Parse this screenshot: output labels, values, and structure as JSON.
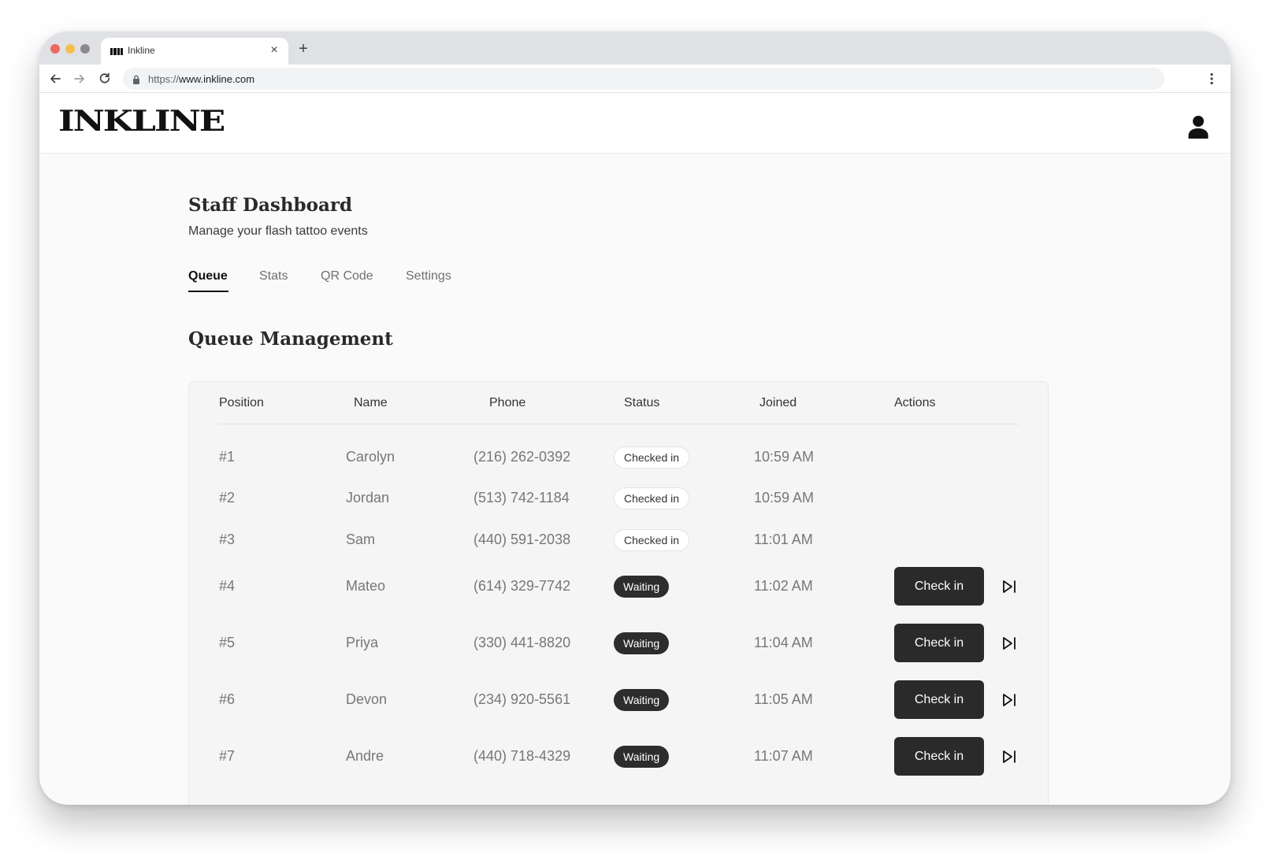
{
  "browser": {
    "tab_title": "Inkline",
    "url_scheme": "https://",
    "url_host": "www.inkline.com",
    "new_tab_label": "+",
    "close_tab_label": "×"
  },
  "site": {
    "logo_text": "INKLINE",
    "account_icon": "user-icon"
  },
  "page": {
    "title": "Staff Dashboard",
    "subtitle": "Manage your flash tattoo events",
    "tabs": [
      {
        "label": "Queue",
        "active": true
      },
      {
        "label": "Stats",
        "active": false
      },
      {
        "label": "QR Code",
        "active": false
      },
      {
        "label": "Settings",
        "active": false
      }
    ],
    "section_title": "Queue Management"
  },
  "table": {
    "headers": {
      "position": "Position",
      "name": "Name",
      "phone": "Phone",
      "status": "Status",
      "joined": "Joined",
      "actions": "Actions"
    },
    "rows": [
      {
        "position": "#1",
        "name": "Carolyn",
        "phone": "(216) 262-0392",
        "status": "Checked in",
        "joined": "10:59 AM",
        "action": ""
      },
      {
        "position": "#2",
        "name": "Jordan",
        "phone": "(513) 742-1184",
        "status": "Checked in",
        "joined": "10:59 AM",
        "action": ""
      },
      {
        "position": "#3",
        "name": "Sam",
        "phone": "(440) 591-2038",
        "status": "Checked in",
        "joined": "11:01 AM",
        "action": ""
      },
      {
        "position": "#4",
        "name": "Mateo",
        "phone": "(614) 329-7742",
        "status": "Waiting",
        "joined": "11:02 AM",
        "action": "Check in"
      },
      {
        "position": "#5",
        "name": "Priya",
        "phone": "(330) 441-8820",
        "status": "Waiting",
        "joined": "11:04 AM",
        "action": "Check in"
      },
      {
        "position": "#6",
        "name": "Devon",
        "phone": "(234) 920-5561",
        "status": "Waiting",
        "joined": "11:05 AM",
        "action": "Check in"
      },
      {
        "position": "#7",
        "name": "Andre",
        "phone": "(440) 718-4329",
        "status": "Waiting",
        "joined": "11:07 AM",
        "action": "Check in"
      }
    ]
  },
  "colors": {
    "primary_dark": "#2a2a2a",
    "muted_text": "#777777",
    "page_bg": "#fafafa"
  }
}
